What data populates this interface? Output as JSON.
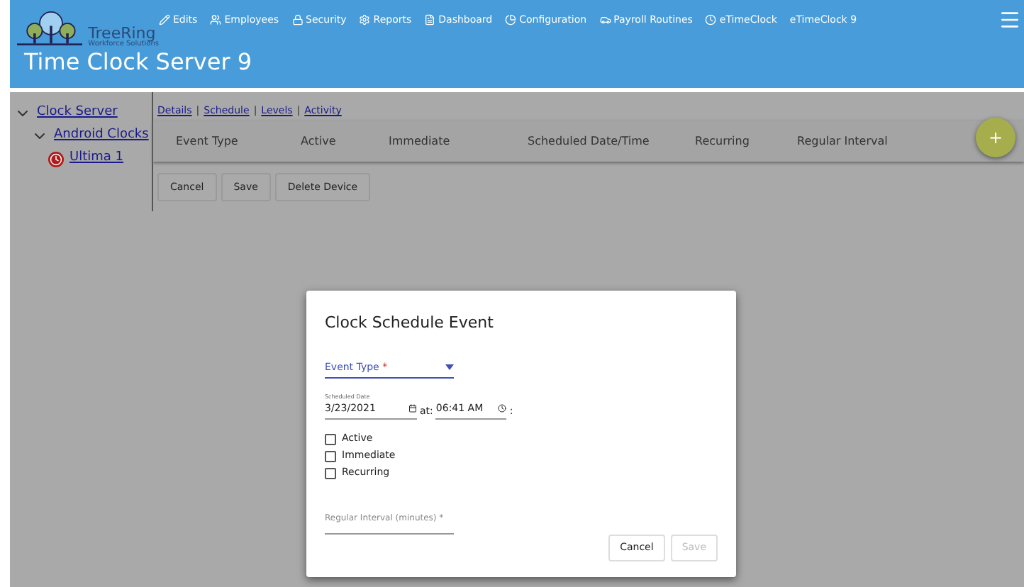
{
  "header": {
    "logo": {
      "name": "TreeRing",
      "tagline": "Workforce Solutions"
    },
    "title": "Time Clock Server 9",
    "nav": [
      {
        "label": "Edits",
        "kind": "pencil"
      },
      {
        "label": "Employees",
        "kind": "people"
      },
      {
        "label": "Security",
        "kind": "lock"
      },
      {
        "label": "Reports",
        "kind": "gear"
      },
      {
        "label": "Dashboard",
        "kind": "doc"
      },
      {
        "label": "Configuration",
        "kind": "pie"
      },
      {
        "label": "Payroll Routines",
        "kind": "car"
      },
      {
        "label": "eTimeClock",
        "kind": "clock"
      },
      {
        "label": "eTimeClock 9",
        "kind": "none"
      }
    ]
  },
  "tree": [
    {
      "label": "Clock Server",
      "expanded": true,
      "children": [
        {
          "label": "Android Clocks",
          "expanded": true,
          "children": [
            {
              "label": "Ultima 1",
              "kind": "clock"
            }
          ]
        }
      ]
    }
  ],
  "tabs": [
    "Details",
    "Schedule",
    "Levels",
    "Activity"
  ],
  "tab_separator": "|",
  "table": {
    "columns": [
      "Event Type",
      "Active",
      "Immediate",
      "Scheduled Date/Time",
      "Recurring",
      "Regular Interval"
    ],
    "add_button": "+"
  },
  "buttons": [
    "Cancel",
    "Save",
    "Delete Device"
  ],
  "dialog": {
    "title": "Clock Schedule Event",
    "event_type": {
      "placeholder": "Event Type",
      "required_mark": "*"
    },
    "date_label": "Scheduled Date",
    "date": "3/23/2021",
    "at": "at:",
    "time": "06:41 AM",
    "time_suffix": ":",
    "checkboxes": [
      {
        "label": "Active",
        "checked": false
      },
      {
        "label": "Immediate",
        "checked": false
      },
      {
        "label": "Recurring",
        "checked": false
      }
    ],
    "interval": {
      "placeholder": "Regular Interval (minutes) *"
    },
    "buttons": [
      {
        "label": "Cancel",
        "disabled": false
      },
      {
        "label": "Save",
        "disabled": true
      }
    ]
  }
}
